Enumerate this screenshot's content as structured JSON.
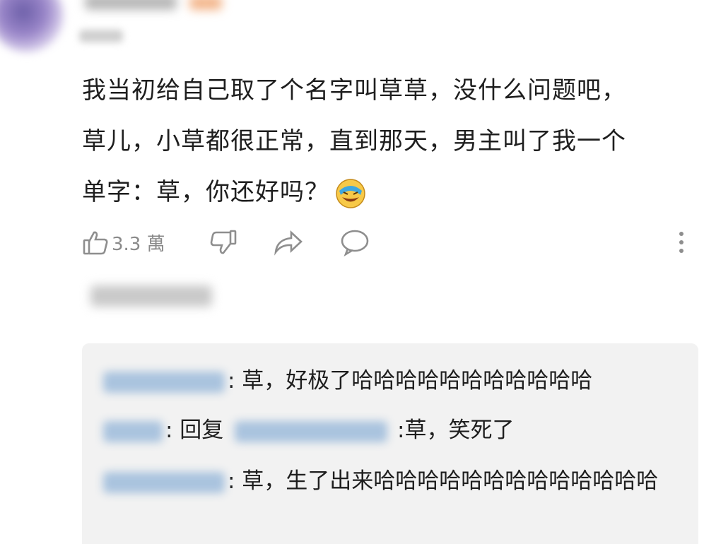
{
  "comment": {
    "line1": "我当初给自己取了个名字叫草草，没什么问题吧，",
    "line2": "草儿，小草都很正常，直到那天，男主叫了我一个",
    "line3": "单字：草，你还好吗？"
  },
  "actions": {
    "like_count": "3.3 萬"
  },
  "replies": [
    {
      "text": ": 草，好极了哈哈哈哈哈哈哈哈哈哈哈"
    },
    {
      "pre": ": 回复 ",
      "post": " :草，笑死了"
    },
    {
      "text": ": 草，生了出来哈哈哈哈哈哈哈哈哈哈哈哈哈"
    }
  ],
  "icons": [
    "thumbs-up-icon",
    "thumbs-down-icon",
    "share-icon",
    "reply-icon",
    "more-icon",
    "laughing-face-icon"
  ],
  "colors": {
    "thread_bg": "#f2f2f2",
    "icon_gray": "#8e8e8e",
    "text": "#1e1e1e"
  }
}
